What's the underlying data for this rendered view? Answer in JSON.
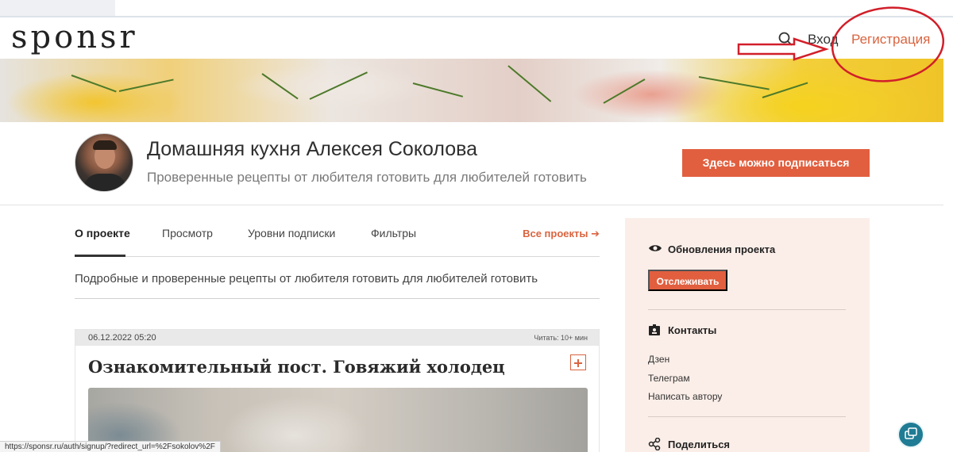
{
  "brand": {
    "logo_text": "sponsr",
    "accent_color": "#e15f3f",
    "link_color": "#d9643f"
  },
  "nav": {
    "search_icon": "search-icon",
    "login_label": "Вход",
    "register_label": "Регистрация"
  },
  "profile": {
    "title": "Домашняя кухня Алексея Соколова",
    "subtitle": "Проверенные рецепты от любителя готовить для любителей готовить",
    "subscribe_label": "Здесь можно подписаться"
  },
  "tabs": {
    "items": [
      {
        "label": "О проекте",
        "active": true
      },
      {
        "label": "Просмотр",
        "active": false
      },
      {
        "label": "Уровни подписки",
        "active": false
      },
      {
        "label": "Фильтры",
        "active": false
      }
    ],
    "all_projects_label": "Все проекты ➔"
  },
  "about": {
    "description": "Подробные и проверенные рецепты от любителя готовить для любителей готовить"
  },
  "post": {
    "date": "06.12.2022 05:20",
    "read_time": "Читать: 10+ мин",
    "title": "Ознакомительный пост. Говяжий холодец"
  },
  "sidebar": {
    "updates_heading": "Обновления проекта",
    "follow_label": "Отслеживать",
    "contacts_heading": "Контакты",
    "contact_links": [
      "Дзен",
      "Телеграм",
      "Написать автору"
    ],
    "share_heading": "Поделиться"
  },
  "status_bar": {
    "url": "https://sponsr.ru/auth/signup/?redirect_url=%2Fsokolov%2F"
  }
}
